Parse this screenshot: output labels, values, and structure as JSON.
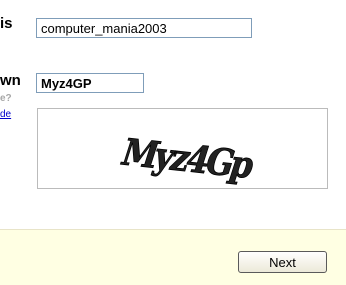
{
  "form": {
    "username_label_fragment": "is",
    "username_value": "computer_mania2003",
    "captcha_label_fragment": "wn",
    "captcha_hint_fragment": "e?",
    "link_fragment": "de",
    "captcha_value": "Myz4GP",
    "captcha_image_text": "Myz4Gp"
  },
  "footer": {
    "next_label": "Next"
  },
  "colors": {
    "footer_background": "#ffffe3",
    "input_border": "#7f9db9",
    "link": "#0000cc"
  }
}
